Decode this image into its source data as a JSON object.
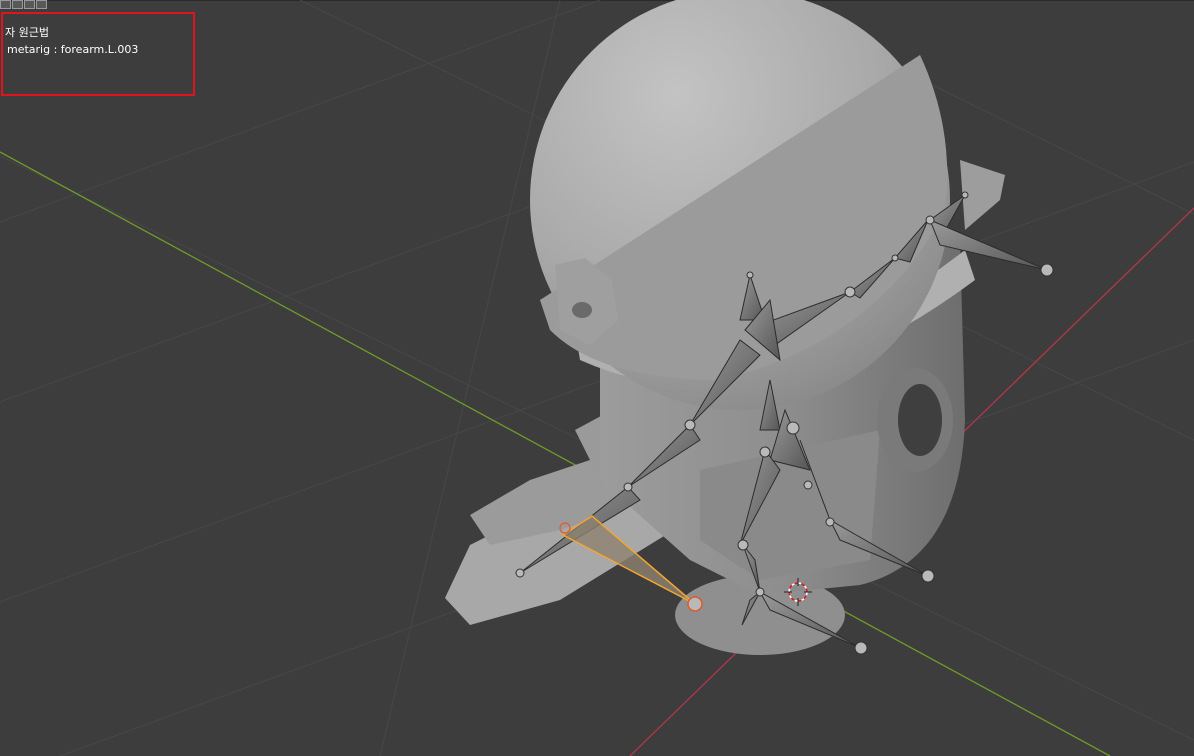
{
  "viewport": {
    "mode_text": "자 원근법",
    "selection_text": "metarig : forearm.L.003"
  },
  "header": {
    "icons": [
      "viewport-shading-icon",
      "overlay-icon",
      "gizmo-icon",
      "xray-icon"
    ]
  },
  "colors": {
    "background": "#3d3d3d",
    "grid": "#474747",
    "axis_x": "#b2374a",
    "axis_y": "#6f9a2a",
    "selected_bone": "#f2a531",
    "highlight_box": "#e0141e"
  }
}
